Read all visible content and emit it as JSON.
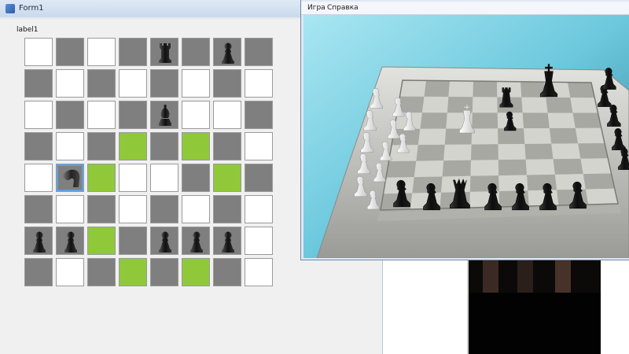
{
  "form1": {
    "title": "Form1",
    "label": "label1"
  },
  "board": {
    "rows": [
      [
        "light",
        "dark",
        "light",
        "dark",
        "dark",
        "dark",
        "dark",
        "dark"
      ],
      [
        "dark",
        "light",
        "dark",
        "light",
        "dark",
        "light",
        "dark",
        "light"
      ],
      [
        "light",
        "dark",
        "light",
        "dark",
        "dark",
        "light",
        "light",
        "dark"
      ],
      [
        "dark",
        "light",
        "dark",
        "hl",
        "dark",
        "hl",
        "dark",
        "light"
      ],
      [
        "light",
        "dark",
        "hl",
        "light",
        "light",
        "dark",
        "hl",
        "dark"
      ],
      [
        "dark",
        "light",
        "dark",
        "light",
        "dark",
        "light",
        "dark",
        "light"
      ],
      [
        "dark",
        "dark",
        "hl",
        "dark",
        "dark",
        "dark",
        "dark",
        "light"
      ],
      [
        "dark",
        "light",
        "dark",
        "hl",
        "dark",
        "hl",
        "dark",
        "light"
      ]
    ],
    "pieces": [
      {
        "row": 0,
        "col": 4,
        "type": "rook",
        "color": "black",
        "icon": "rook-icon"
      },
      {
        "row": 0,
        "col": 6,
        "type": "pawn",
        "color": "black",
        "icon": "pawn-icon"
      },
      {
        "row": 2,
        "col": 4,
        "type": "bishop",
        "color": "black",
        "icon": "bishop-icon"
      },
      {
        "row": 4,
        "col": 1,
        "type": "knight",
        "color": "black",
        "icon": "knight-icon",
        "selected": true
      },
      {
        "row": 6,
        "col": 0,
        "type": "pawn",
        "color": "black",
        "icon": "pawn-icon"
      },
      {
        "row": 6,
        "col": 1,
        "type": "pawn",
        "color": "black",
        "icon": "pawn-icon"
      },
      {
        "row": 6,
        "col": 4,
        "type": "pawn",
        "color": "black",
        "icon": "pawn-icon"
      },
      {
        "row": 6,
        "col": 5,
        "type": "pawn",
        "color": "black",
        "icon": "pawn-icon"
      },
      {
        "row": 6,
        "col": 6,
        "type": "pawn",
        "color": "black",
        "icon": "pawn-icon"
      }
    ],
    "colors": {
      "light": "#ffffff",
      "dark": "#7f7f7f",
      "highlight": "#8fc93a"
    }
  },
  "chess_window": {
    "menu": [
      "Игра",
      "Справка"
    ]
  }
}
